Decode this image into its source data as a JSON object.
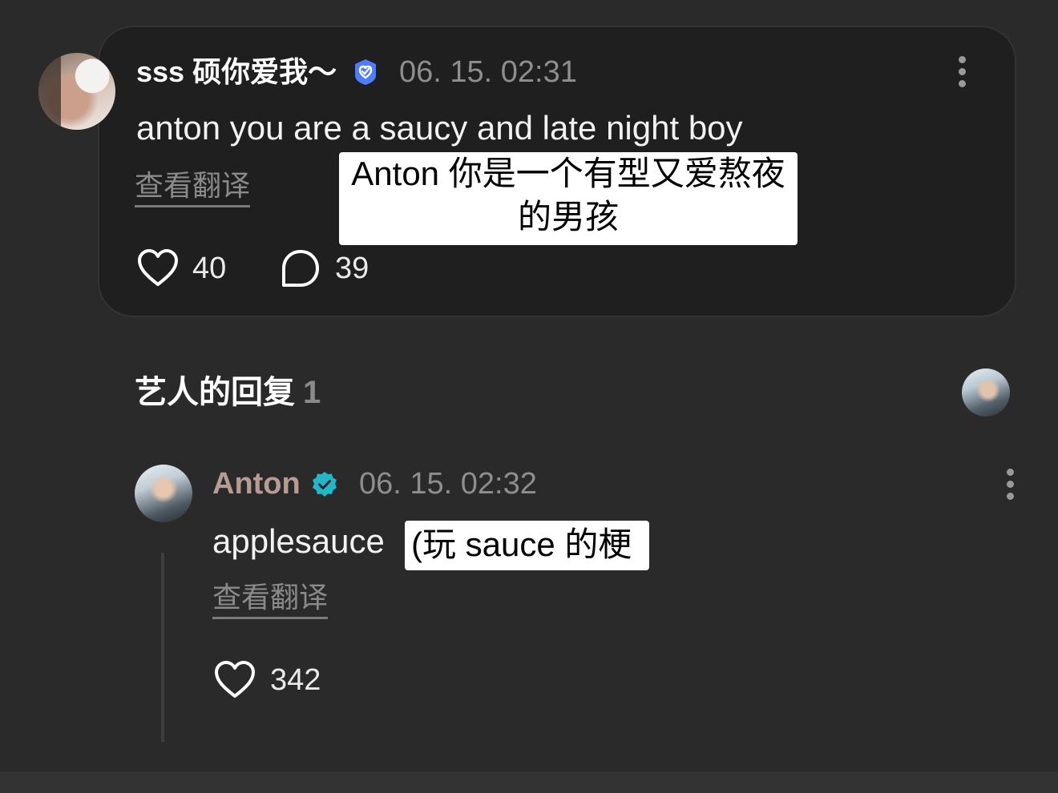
{
  "comment": {
    "username": "sss 硕你爱我～",
    "timestamp": "06. 15. 02:31",
    "text": "anton you are a saucy and late night boy",
    "translate_label": "查看翻译",
    "likes": "40",
    "replies": "39",
    "overlay_line1": "Anton 你是一个有型又爱熬夜",
    "overlay_line2": "的男孩",
    "badge_color": "#4f7cff"
  },
  "artist_reply": {
    "section_title": "艺人的回复",
    "section_count": "1",
    "author": "Anton",
    "timestamp": "06. 15. 02:32",
    "text": "applesauce",
    "overlay": "(玩 sauce 的梗",
    "translate_label": "查看翻译",
    "likes": "342",
    "badge_color": "#1fb8c9"
  }
}
